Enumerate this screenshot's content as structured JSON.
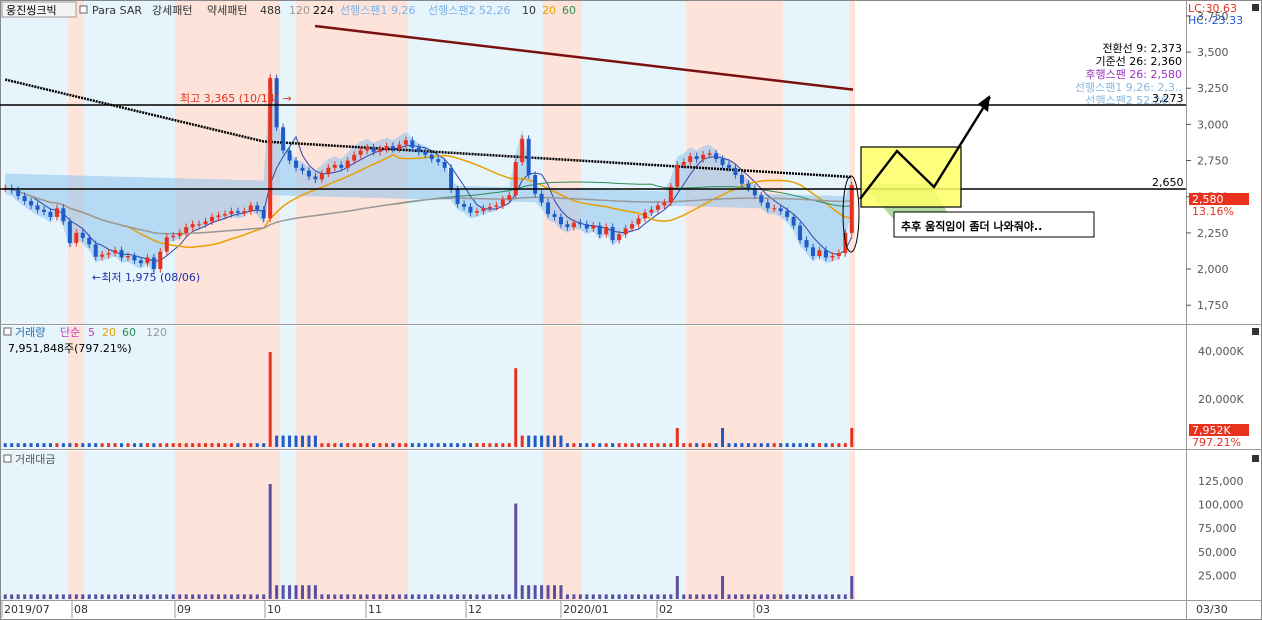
{
  "header": {
    "stock_name": "웅진씽크빅",
    "indicators": [
      {
        "label": "Para SAR",
        "color": "#333333"
      },
      {
        "label": "강세패턴",
        "color": "#333333"
      },
      {
        "label": "약세패턴",
        "color": "#333333"
      },
      {
        "label": "488",
        "color": "#333333"
      },
      {
        "label": "120",
        "color": "#999999"
      },
      {
        "label": "224",
        "color": "#000000"
      },
      {
        "label": "선행스팬1 9,26",
        "color": "#7fb2e8"
      },
      {
        "label": "선행스팬2 52,26",
        "color": "#7fb2e8"
      },
      {
        "label": "10",
        "color": "#333333"
      },
      {
        "label": "20",
        "color": "#e8a000"
      },
      {
        "label": "60",
        "color": "#2e8b57"
      }
    ],
    "lc": "LC:30.63",
    "hc": "HC:-23.33"
  },
  "ichimoku_info": [
    {
      "label": "전환선 9: 2,373",
      "color": "#000000"
    },
    {
      "label": "기준선 26: 2,360",
      "color": "#000000"
    },
    {
      "label": "후행스팬 26: 2,580",
      "color": "#9b30c0"
    },
    {
      "label": "선행스팬1 9,26: 2,3..",
      "color": "#8ab8e0"
    },
    {
      "label": "선행스팬2 52,26: ..",
      "color": "#8ab8e0"
    }
  ],
  "annotations": {
    "high": "최고 3,365 (10/14) →",
    "low": "←최저 1,975 (08/06)",
    "resistance_label": "3,273",
    "support_label": "2,650",
    "note": "추후 움직임이 좀더 나와줘야.."
  },
  "price_badge": {
    "value": "2,580",
    "change": "13.16%",
    "color": "#e8321e"
  },
  "volume_panel": {
    "title": "거래량",
    "ma_label": "단순",
    "ma_periods": [
      {
        "label": "5",
        "color": "#c040c0"
      },
      {
        "label": "20",
        "color": "#e8a000"
      },
      {
        "label": "60",
        "color": "#2e8b57"
      },
      {
        "label": "120",
        "color": "#999999"
      }
    ],
    "current": "7,951,848주(797.21%)",
    "badge_value": "7,952K",
    "badge_pct": "797.21%"
  },
  "amount_panel": {
    "title": "거래대금"
  },
  "x_axis": {
    "labels": [
      "2019/07",
      "08",
      "09",
      "10",
      "11",
      "12",
      "2020/01",
      "02",
      "03"
    ],
    "right_label": "03/30"
  },
  "chart_data": [
    {
      "type": "candlestick",
      "yticks": [
        1750,
        2000,
        2250,
        2500,
        2750,
        3000,
        3250,
        3500,
        3750
      ],
      "ytick_labels": [
        "1,750",
        "2,000",
        "2,250",
        "2,500",
        "2,750",
        "3,000",
        "3,250",
        "3,500",
        "3,750"
      ],
      "ylim": [
        1620,
        3860
      ],
      "high": 3365,
      "low": 1975,
      "last": 2580,
      "horizontal_lines": [
        3273,
        2650
      ],
      "trendline": [
        3680,
        3240
      ],
      "close": [
        2560,
        2545,
        2505,
        2470,
        2440,
        2410,
        2395,
        2360,
        2420,
        2330,
        2180,
        2250,
        2215,
        2170,
        2085,
        2100,
        2110,
        2130,
        2080,
        2090,
        2060,
        2040,
        2080,
        2000,
        2120,
        2220,
        2230,
        2250,
        2290,
        2310,
        2310,
        2330,
        2360,
        2370,
        2380,
        2400,
        2390,
        2400,
        2440,
        2410,
        2350,
        3320,
        2980,
        2820,
        2750,
        2700,
        2680,
        2640,
        2620,
        2660,
        2700,
        2720,
        2700,
        2750,
        2790,
        2820,
        2840,
        2810,
        2830,
        2850,
        2830,
        2860,
        2890,
        2840,
        2810,
        2790,
        2760,
        2740,
        2700,
        2550,
        2450,
        2430,
        2390,
        2400,
        2420,
        2430,
        2440,
        2480,
        2510,
        2740,
        2900,
        2650,
        2520,
        2460,
        2380,
        2360,
        2310,
        2290,
        2320,
        2310,
        2280,
        2300,
        2240,
        2290,
        2200,
        2240,
        2280,
        2310,
        2350,
        2390,
        2410,
        2440,
        2460,
        2570,
        2720,
        2740,
        2780,
        2760,
        2790,
        2800,
        2760,
        2720,
        2700,
        2650,
        2590,
        2560,
        2510,
        2460,
        2420,
        2420,
        2400,
        2360,
        2300,
        2200,
        2150,
        2090,
        2130,
        2080,
        2090,
        2110,
        2250,
        2580
      ],
      "volume_k": {
        "max_tick_label": "40,000K",
        "mid_tick_label": "20,000K",
        "last": 7952
      },
      "amount": {
        "yticks": [
          25000,
          50000,
          75000,
          100000,
          125000
        ],
        "ytick_labels": [
          "25,000",
          "50,000",
          "75,000",
          "100,000",
          "125,000"
        ]
      }
    }
  ]
}
